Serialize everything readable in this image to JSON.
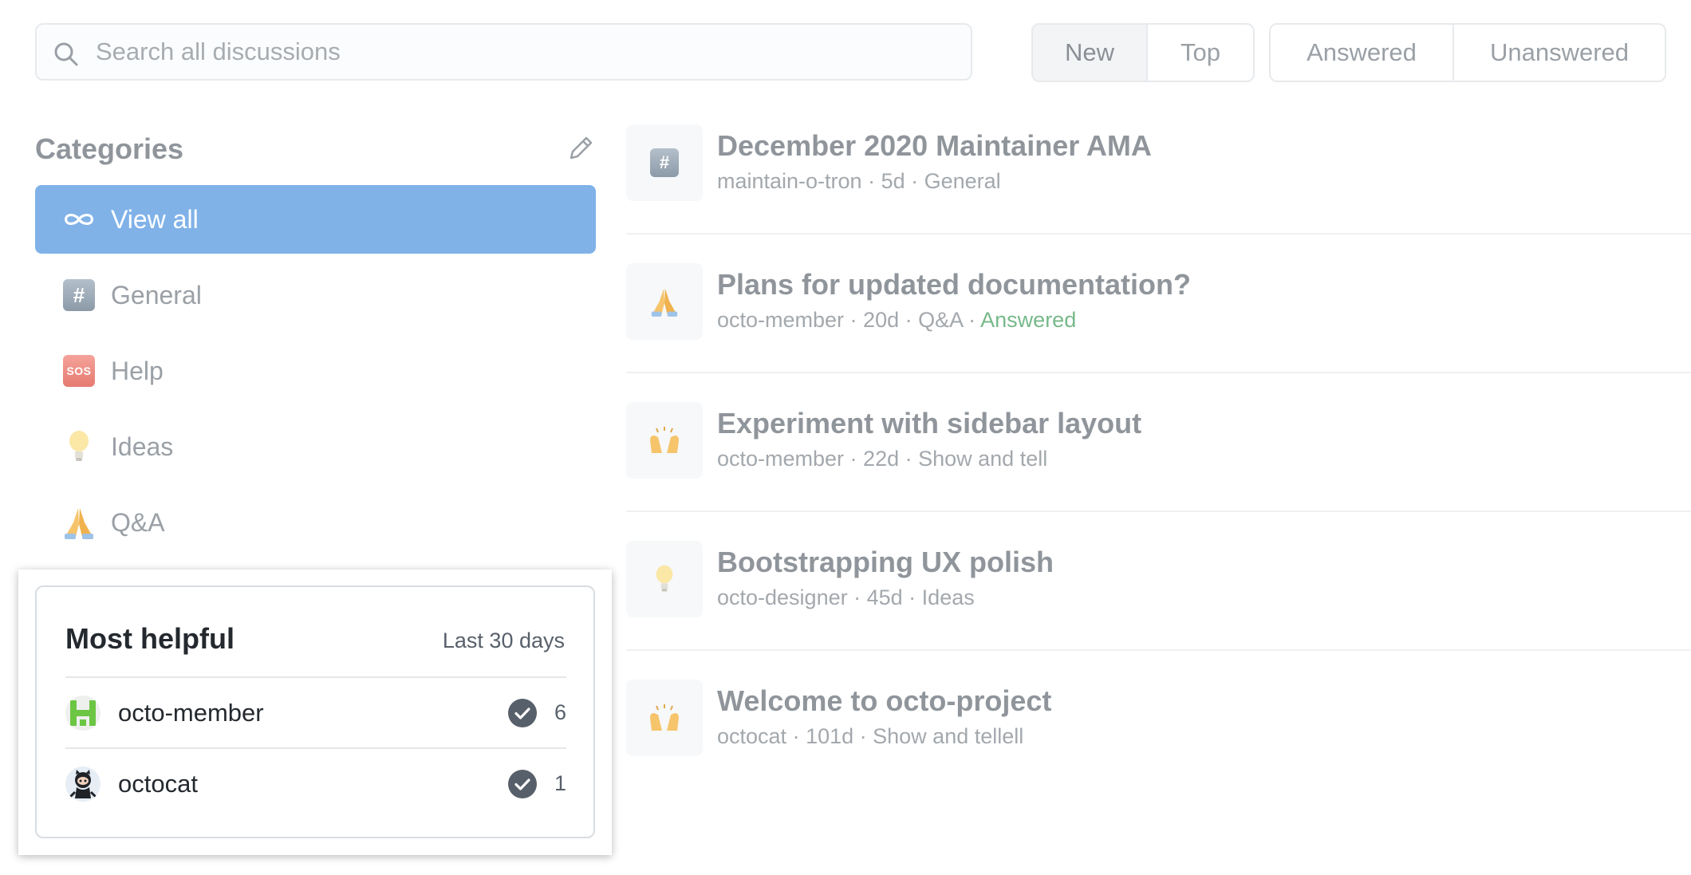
{
  "search": {
    "placeholder": "Search all discussions",
    "icon": "search-icon"
  },
  "sort_filters": [
    {
      "label": "New",
      "active": true
    },
    {
      "label": "Top",
      "active": false
    }
  ],
  "status_filters": [
    {
      "label": "Answered",
      "active": false
    },
    {
      "label": "Unanswered",
      "active": false
    }
  ],
  "categories": {
    "title": "Categories",
    "edit_icon": "pencil-icon",
    "items": [
      {
        "label": "View all",
        "icon": "infinity-icon",
        "active": true
      },
      {
        "label": "General",
        "icon": "hash-icon"
      },
      {
        "label": "Help",
        "icon": "sos-icon"
      },
      {
        "label": "Ideas",
        "icon": "lightbulb-icon"
      },
      {
        "label": "Q&A",
        "icon": "pray-icon"
      }
    ]
  },
  "discussions": [
    {
      "title": "December 2020 Maintainer AMA",
      "author": "maintain-o-tron",
      "age": "5d",
      "category": "General",
      "icon": "hash-icon"
    },
    {
      "title": "Plans for updated documentation?",
      "author": "octo-member",
      "age": "20d",
      "category": "Q&A",
      "status": "Answered",
      "icon": "pray-icon"
    },
    {
      "title": "Experiment with sidebar layout",
      "author": "octo-member",
      "age": "22d",
      "category": "Show and tell",
      "icon": "raised-hands-icon"
    },
    {
      "title": "Bootstrapping UX polish",
      "author": "octo-designer",
      "age": "45d",
      "category": "Ideas",
      "icon": "lightbulb-icon"
    },
    {
      "title": "Welcome to octo-project",
      "author": "octocat",
      "age": "101d",
      "category": "Show and tell",
      "icon": "raised-hands-icon",
      "overlap": "ell"
    }
  ],
  "most_helpful": {
    "title": "Most helpful",
    "range": "Last 30 days",
    "users": [
      {
        "name": "octo-member",
        "count": "6",
        "avatar": "identicon-avatar"
      },
      {
        "name": "octocat",
        "count": "1",
        "avatar": "octocat-avatar"
      }
    ]
  },
  "colors": {
    "accent": "#80b2e8",
    "answered": "#77b98a",
    "text_muted": "#9aa0a6"
  }
}
